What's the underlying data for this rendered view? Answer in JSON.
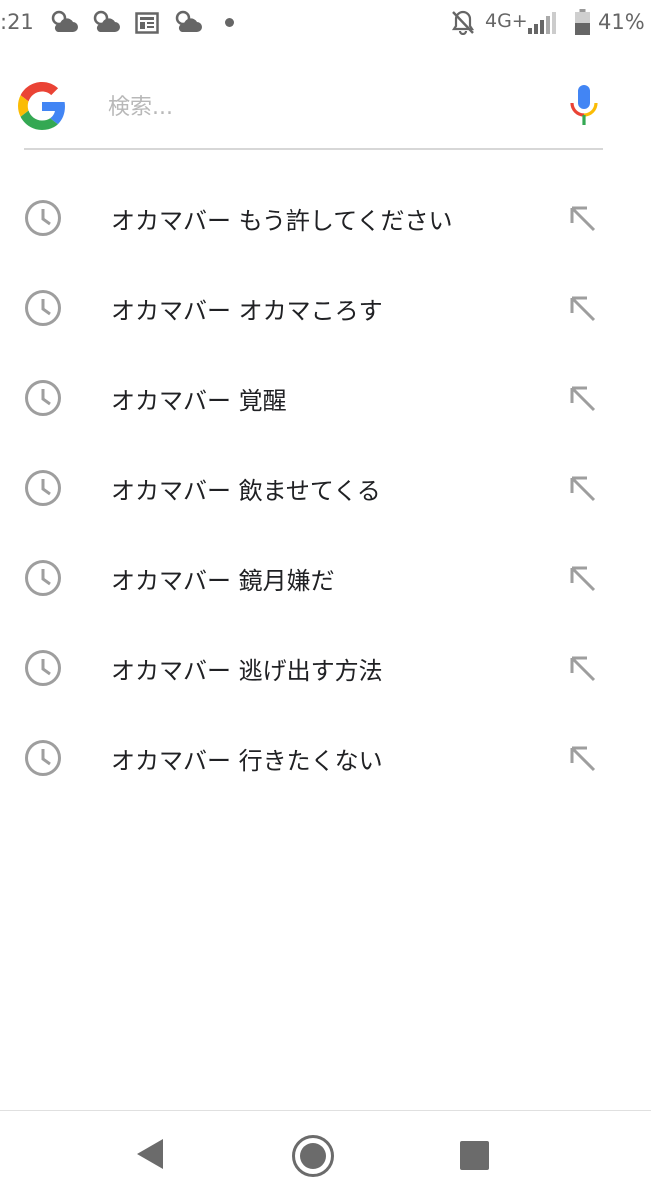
{
  "status_bar": {
    "time": ":21",
    "network": "4G+",
    "battery": "41%",
    "icons": [
      "weather-cloud-icon",
      "weather-cloud-icon",
      "news-icon",
      "weather-cloud-icon",
      "dot-icon",
      "alarm-off-icon",
      "signal-icon",
      "battery-icon"
    ]
  },
  "search": {
    "placeholder": "検索...",
    "value": "",
    "logo_icon": "google-g-icon",
    "mic_icon": "microphone-icon",
    "colors": {
      "blue": "#4285F4",
      "red": "#EA4335",
      "yellow": "#FBBC05",
      "green": "#34A853"
    }
  },
  "suggestions": [
    {
      "text": "オカマバー もう許してください"
    },
    {
      "text": "オカマバー オカマころす"
    },
    {
      "text": "オカマバー 覚醒"
    },
    {
      "text": "オカマバー 飲ませてくる"
    },
    {
      "text": "オカマバー 鏡月嫌だ"
    },
    {
      "text": "オカマバー 逃げ出す方法"
    },
    {
      "text": "オカマバー 行きたくない"
    }
  ],
  "nav_bar": {
    "icons": [
      "back-icon",
      "home-icon",
      "recents-icon"
    ]
  }
}
